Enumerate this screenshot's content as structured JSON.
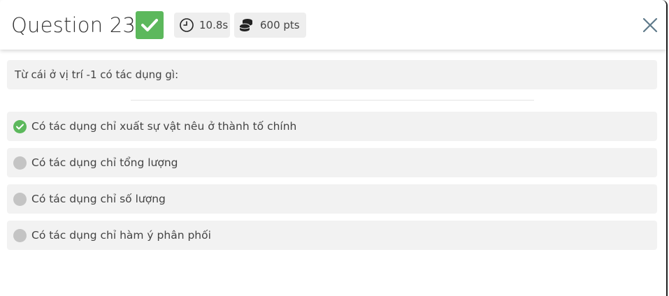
{
  "header": {
    "title": "Question 23",
    "status_icon": "check-icon",
    "time": "10.8s",
    "time_icon": "clock-icon",
    "points": "600 pts",
    "points_icon": "coins-icon",
    "close_icon": "close-icon"
  },
  "question": {
    "text": "Từ cái ở vị trí -1 có tác dụng gì:"
  },
  "options": [
    {
      "label": "Có tác dụng chỉ xuất sự vật nêu ở thành tố chính",
      "state": "correct"
    },
    {
      "label": "Có tác dụng chỉ tổng lượng",
      "state": "neutral"
    },
    {
      "label": "Có tác dụng chỉ số lượng",
      "state": "neutral"
    },
    {
      "label": "Có tác dụng chỉ hàm ý phân phối",
      "state": "neutral"
    }
  ],
  "colors": {
    "correct": "#5cb85c",
    "neutral": "#c4c4c4",
    "panel_bg": "#f2f2f2",
    "chip_bg": "#eeeeee",
    "text": "#444444"
  }
}
